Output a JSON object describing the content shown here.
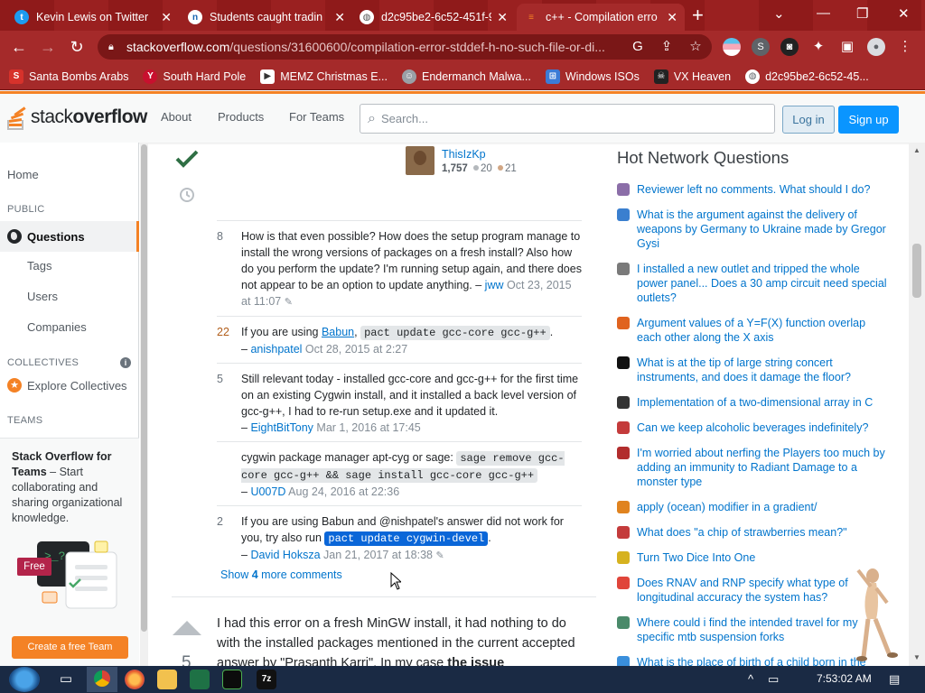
{
  "browser": {
    "tabs": [
      {
        "title": "Kevin Lewis on Twitter",
        "favicon": "twitter-icon"
      },
      {
        "title": "Students caught tradin",
        "favicon": "news-icon"
      },
      {
        "title": "d2c95be2-6c52-451f-9",
        "favicon": "globe-icon"
      },
      {
        "title": "c++ - Compilation erro",
        "favicon": "stackoverflow-icon",
        "active": true
      }
    ],
    "url_domain": "stackoverflow.com",
    "url_path": "/questions/31600600/compilation-error-stddef-h-no-such-file-or-di...",
    "bookmarks": [
      {
        "label": "Santa Bombs Arabs",
        "icon": "santa-icon",
        "color": "#d7322b"
      },
      {
        "label": "South Hard Pole",
        "icon": "yahoo-icon",
        "color": "#c8102e"
      },
      {
        "label": "MEMZ Christmas E...",
        "icon": "video-icon",
        "color": "#ffffff"
      },
      {
        "label": "Endermanch Malwa...",
        "icon": "ghost-icon",
        "color": "#9aa0a6"
      },
      {
        "label": "Windows ISOs",
        "icon": "windows-icon",
        "color": "#3c7bd6"
      },
      {
        "label": "VX Heaven",
        "icon": "skull-icon",
        "color": "#222222"
      },
      {
        "label": "d2c95be2-6c52-45...",
        "icon": "globe-icon",
        "color": "#5f6368"
      }
    ]
  },
  "so_header": {
    "logo_word1": "stack",
    "logo_word2": "overflow",
    "nav": [
      "About",
      "Products",
      "For Teams"
    ],
    "search_placeholder": "Search...",
    "login": "Log in",
    "signup": "Sign up",
    "accent": "#f48225"
  },
  "leftnav": {
    "home": "Home",
    "public_head": "PUBLIC",
    "questions": "Questions",
    "tags": "Tags",
    "users": "Users",
    "companies": "Companies",
    "collectives_head": "COLLECTIVES",
    "explore_collectives": "Explore Collectives",
    "teams_head": "TEAMS",
    "teams_title": "Stack Overflow for Teams",
    "teams_desc": " – Start collaborating and sharing organizational knowledge.",
    "free_badge": "Free",
    "create_team": "Create a free Team"
  },
  "answer_meta": {
    "user": "ThisIzKp",
    "reputation": "1,757",
    "silver": "20",
    "bronze": "21"
  },
  "comments": [
    {
      "score": "8",
      "hot": false,
      "text": "How is that even possible? How does the setup program manage to install the wrong versions of packages on a fresh install? Also how do you perform the update? I'm running setup again, and there does not appear to be an option to update anything. – ",
      "user": "jww",
      "date": "Oct 23, 2015 at 11:07"
    },
    {
      "score": "22",
      "hot": true,
      "pre": "If you are using ",
      "link": "Babun",
      "mid": ", ",
      "code": "pact update gcc-core gcc-g++",
      "post": ".",
      "user": "anishpatel",
      "date": "Oct 28, 2015 at 2:27"
    },
    {
      "score": "5",
      "hot": false,
      "text": "Still relevant today - installed gcc-core and gcc-g++ for the first time on an existing Cygwin install, and it installed a back level version of gcc-g++, I had to re-run setup.exe and it updated it.",
      "user": "EightBitTony",
      "date": "Mar 1, 2016 at 17:45"
    },
    {
      "score": "",
      "hot": false,
      "pre": "cygwin package manager apt-cyg or sage: ",
      "code": "sage remove gcc-core gcc-g++ && sage install gcc-core gcc-g++",
      "user": "U007D",
      "date": "Aug 24, 2016 at 22:36"
    },
    {
      "score": "2",
      "hot": false,
      "pre": "If you are using Babun and @nishpatel's answer did not work for you, try also run ",
      "code": "pact update cygwin-devel",
      "post": ".",
      "user": "David Hoksza",
      "date": "Jan 21, 2017 at 18:38"
    }
  ],
  "show_more": {
    "pre": "Show ",
    "count": "4",
    "post": " more comments"
  },
  "next_answer": {
    "votes": "5",
    "text_pre": "I had this error on a fresh MinGW install, it had nothing to do with the installed packages mentioned in the current accepted answer by \"Prasanth Karri\". In my case ",
    "text_bold": "the issue"
  },
  "hot_network": {
    "title": "Hot Network Questions",
    "items": [
      {
        "text": "Reviewer left no comments. What should I do?",
        "color": "#8b6ea8"
      },
      {
        "text": "What is the argument against the delivery of weapons by Germany to Ukraine made by Gregor Gysi",
        "color": "#3a7fcf"
      },
      {
        "text": "I installed a new outlet and tripped the whole power panel... Does a 30 amp circuit need special outlets?",
        "color": "#7a7a7a"
      },
      {
        "text": "Argument values of a Y=F(X) function overlap each other along the X axis",
        "color": "#e0631f"
      },
      {
        "text": "What is at the tip of large string concert instruments, and does it damage the floor?",
        "color": "#111111"
      },
      {
        "text": "Implementation of a two-dimensional array in C",
        "color": "#333333"
      },
      {
        "text": "Can we keep alcoholic beverages indefinitely?",
        "color": "#c43b3b"
      },
      {
        "text": "I'm worried about nerfing the Players too much by adding an immunity to Radiant Damage to a monster type",
        "color": "#b22d2d"
      },
      {
        "text": "apply (ocean) modifier in a gradient/",
        "color": "#e0831f"
      },
      {
        "text": "What does \"a chip of strawberries mean?\"",
        "color": "#c43b3b"
      },
      {
        "text": "Turn Two Dice Into One",
        "color": "#d6b21f"
      },
      {
        "text": "Does RNAV and RNP specify what type of longitudinal accuracy the system has?",
        "color": "#e0453a"
      },
      {
        "text": "Where could i find the intended travel for my specific mtb suspension forks",
        "color": "#4a8a6a"
      },
      {
        "text": "What is the place of birth of a child born in the embassy?",
        "color": "#3a8fdc"
      }
    ]
  },
  "taskbar": {
    "clock": "7:53:02 AM"
  }
}
